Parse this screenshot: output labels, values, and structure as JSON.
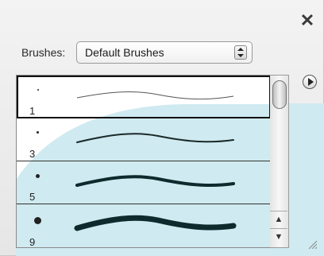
{
  "panel": {
    "close_glyph": "✕",
    "brushes_label": "Brushes:",
    "preset_select": {
      "value": "Default Brushes"
    },
    "brush_rows": [
      {
        "size_label": "1"
      },
      {
        "size_label": "3"
      },
      {
        "size_label": "5"
      },
      {
        "size_label": "9"
      }
    ],
    "scroll_up_glyph": "▲",
    "scroll_down_glyph": "▼"
  },
  "icons": {
    "close": "close-icon",
    "menu": "flyout-menu-icon",
    "stepper": "up-down-stepper-icon",
    "resize": "resize-grip-icon"
  },
  "colors": {
    "accent_tint": "#cfeaf0",
    "stroke": "#0f2a2c",
    "selection": "#111111"
  }
}
